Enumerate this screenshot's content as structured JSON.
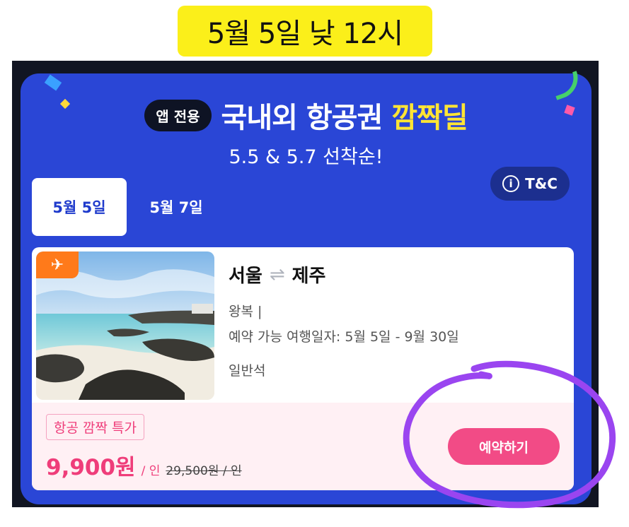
{
  "caption": "5월 5일 낮 12시",
  "banner": {
    "badge": "앱 전용",
    "title_main": "국내외 항공권",
    "title_highlight": "깜짝딜",
    "subtitle": "5.5 & 5.7 선착순!",
    "tc_label": "T&C",
    "tc_icon_glyph": "i",
    "accent_color": "#2a46d6",
    "highlight_color": "#ffe534"
  },
  "tabs": [
    {
      "label": "5월 5일",
      "selected": true
    },
    {
      "label": "5월 7일",
      "selected": false
    }
  ],
  "deal": {
    "plane_icon_glyph": "✈",
    "origin": "서울",
    "route_arrow": "⇌",
    "destination": "제주",
    "trip_type": "왕복 |",
    "travel_period": "예약 가능 여행일자:  5월 5일  - 9월 30일",
    "seat_class": "일반석",
    "badge": "항공 깜짝 특가",
    "price": "9,900원",
    "price_unit": "/ 인",
    "original_price": "29,500원 / 인",
    "book_label": "예약하기",
    "price_color": "#ef3d7a"
  }
}
